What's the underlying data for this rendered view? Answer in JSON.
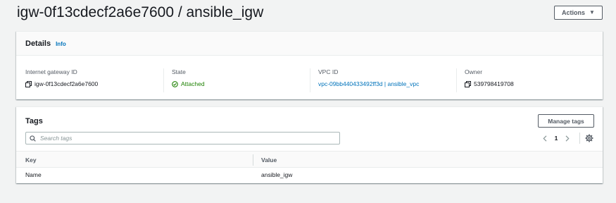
{
  "page": {
    "title": "igw-0f13cdecf2a6e7600 / ansible_igw",
    "actions_label": "Actions"
  },
  "details": {
    "title": "Details",
    "info_label": "Info",
    "columns": [
      {
        "label": "Internet gateway ID",
        "value": "igw-0f13cdecf2a6e7600"
      },
      {
        "label": "State",
        "value": "Attached"
      },
      {
        "label": "VPC ID",
        "value": "vpc-09bb440433492ff3d | ansible_vpc"
      },
      {
        "label": "Owner",
        "value": "539798419708"
      }
    ]
  },
  "tags": {
    "title": "Tags",
    "manage_label": "Manage tags",
    "search_placeholder": "Search tags",
    "page_number": "1",
    "columns": {
      "key": "Key",
      "value": "Value"
    },
    "rows": [
      {
        "key": "Name",
        "value": "ansible_igw"
      }
    ]
  },
  "colors": {
    "link": "#0073bb",
    "success": "#1d8102",
    "text": "#16191f",
    "secondary_text": "#545b64",
    "background": "#f2f3f3"
  },
  "icons": [
    "copy-icon",
    "check-circle-icon",
    "search-icon",
    "chevron-left-icon",
    "chevron-right-icon",
    "gear-icon",
    "caret-down-icon"
  ]
}
